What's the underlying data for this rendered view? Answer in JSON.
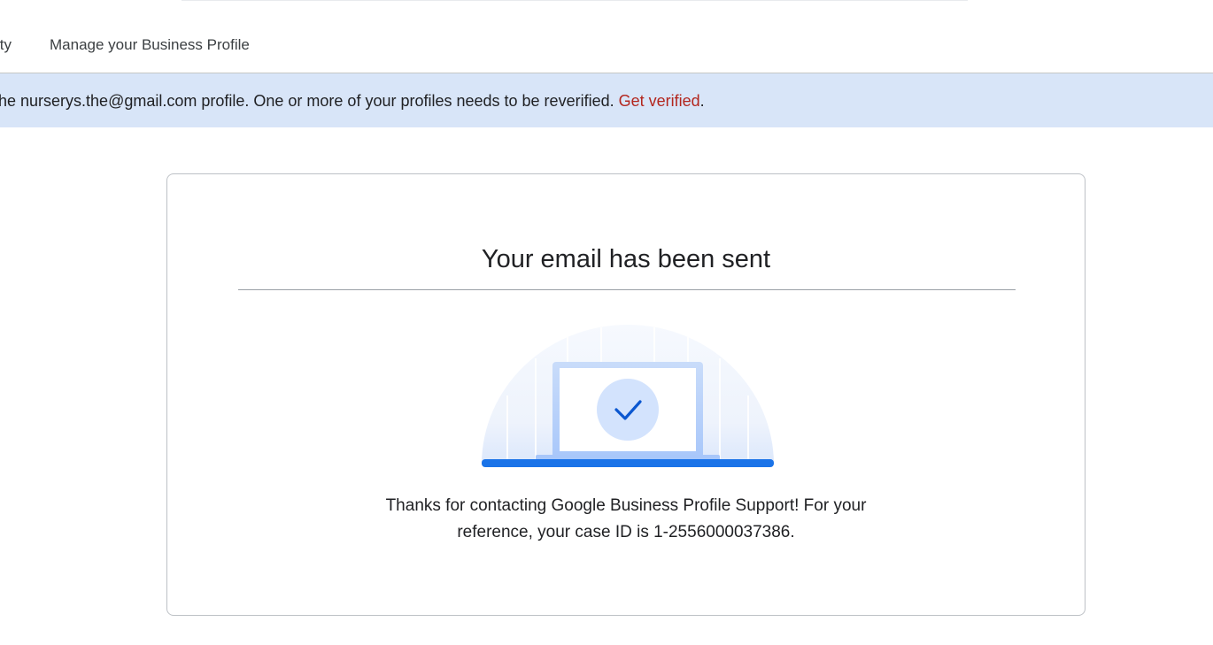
{
  "nav": {
    "partial_item_label": "ity",
    "manage_label": "Manage your Business Profile"
  },
  "banner": {
    "text": "he nurserys.the@gmail.com profile. One or more of your profiles needs to be reverified.",
    "link_label": "Get verified",
    "suffix": ".",
    "background_color": "#d8e5f8",
    "link_color": "#b3261e"
  },
  "card": {
    "title": "Your email has been sent",
    "illustration_icon": "check-icon",
    "message_line1": "Thanks for contacting Google Business Profile Support! For your",
    "message_line2": "reference, your case ID is 1-2556000037386.",
    "accent_color": "#1a73e8"
  }
}
